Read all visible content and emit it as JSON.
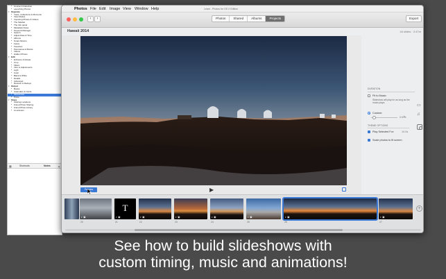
{
  "tutorial": {
    "toc": [
      {
        "label": "Course Introduction",
        "level": 1
      },
      {
        "label": "Launching Photos",
        "level": 1
      },
      {
        "label": "Organize",
        "level": 0,
        "chapter": true
      },
      {
        "label": "Years, Collections & Moments",
        "level": 1
      },
      {
        "label": "View Modes",
        "level": 1
      },
      {
        "label": "Importing Photos & Videos",
        "level": 1
      },
      {
        "label": "The Sidebar",
        "level": 1
      },
      {
        "label": "The Info panel",
        "level": 1
      },
      {
        "label": "Metadata Views",
        "level": 1
      },
      {
        "label": "Keyword Manager",
        "level": 1
      },
      {
        "label": "Search",
        "level": 1
      },
      {
        "label": "Adjust Date & Time",
        "level": 1
      },
      {
        "label": "Albums",
        "level": 1
      },
      {
        "label": "Smart Albums",
        "level": 1
      },
      {
        "label": "Faces",
        "level": 1
      },
      {
        "label": "Favorites",
        "level": 1
      },
      {
        "label": "Panoramas & Bursts",
        "level": 1
      },
      {
        "label": "Videos",
        "level": 1
      },
      {
        "label": "Hidden Photos",
        "level": 1
      },
      {
        "label": "Edit",
        "level": 0,
        "chapter": true
      },
      {
        "label": "Enhance & Rotate",
        "level": 1
      },
      {
        "label": "Crop",
        "level": 1
      },
      {
        "label": "Filters",
        "level": 1
      },
      {
        "label": "Intro to Adjustments",
        "level": 1
      },
      {
        "label": "Light",
        "level": 1
      },
      {
        "label": "Color",
        "level": 1
      },
      {
        "label": "Black & White",
        "level": 1
      },
      {
        "label": "Details",
        "level": 1
      },
      {
        "label": "Advanced",
        "level": 1
      },
      {
        "label": "Retouch & Redeye",
        "level": 1
      },
      {
        "label": "Output",
        "level": 0,
        "chapter": true
      },
      {
        "label": "Books",
        "level": 1
      },
      {
        "label": "Calendars & Cards",
        "level": 1
      },
      {
        "label": "Slideshows",
        "level": 1,
        "selected": true
      },
      {
        "label": "Prints",
        "level": 1
      },
      {
        "label": "Share",
        "level": 0,
        "chapter": true
      },
      {
        "label": "Sharing Locations",
        "level": 1
      },
      {
        "label": "iCloud Photo Sharing",
        "level": 1
      },
      {
        "label": "iCloud Photo Library",
        "level": 1
      },
      {
        "label": "Conclusion",
        "level": 1
      }
    ],
    "tabs": {
      "shortcuts": "Shortcuts",
      "notes": "Notes"
    }
  },
  "menubar": {
    "app": "Photos",
    "items": [
      "File",
      "Edit",
      "Image",
      "View",
      "Window",
      "Help"
    ],
    "window_title": "Learn - Photos for OS X Edition"
  },
  "toolbar": {
    "tabs": [
      {
        "label": "Photos",
        "active": false
      },
      {
        "label": "Shared",
        "active": false
      },
      {
        "label": "Albums",
        "active": false
      },
      {
        "label": "Projects",
        "active": true
      }
    ],
    "export_label": "Export"
  },
  "project": {
    "title": "Hawaii 2014",
    "info": "44 slides · 2:47m"
  },
  "canvas": {
    "preview_label": "Preview",
    "play_glyph": "▶"
  },
  "inspector": {
    "duration_heading": "DURATION",
    "fit_to_music": "Fit to Music:",
    "fit_to_music_note": "Slideshow will play for as long as the music plays.",
    "custom_label": "Custom:",
    "custom_value": "2:47m",
    "theme_heading": "THEME OPTIONS",
    "play_selected_for": "Play Selected For:",
    "play_selected_value": "10.0s",
    "scale_photos": "Scale photos to fit screen",
    "fit_to_music_checked": false,
    "custom_selected": true,
    "play_selected_checked": true,
    "scale_photos_checked": true,
    "slider_level": 0.12
  },
  "filmstrip": {
    "slides": [
      {
        "num": "",
        "kind": "partial"
      },
      {
        "num": "20",
        "kind": "building"
      },
      {
        "num": "21",
        "kind": "title",
        "glyph": "T"
      },
      {
        "num": "22",
        "kind": "sunset"
      },
      {
        "num": "23",
        "kind": "sunset2"
      },
      {
        "num": "24",
        "kind": "sunset3"
      },
      {
        "num": "25",
        "kind": "observatory"
      },
      {
        "num": "26",
        "kind": "panorama"
      },
      {
        "num": "27",
        "kind": "sunset"
      }
    ],
    "add_glyph": "+"
  },
  "caption": {
    "line1": "See how to build slideshows with",
    "line2": "custom timing, music and animations!"
  },
  "colors": {
    "accent": "#3a78d6",
    "background": "#4a4a4a"
  }
}
